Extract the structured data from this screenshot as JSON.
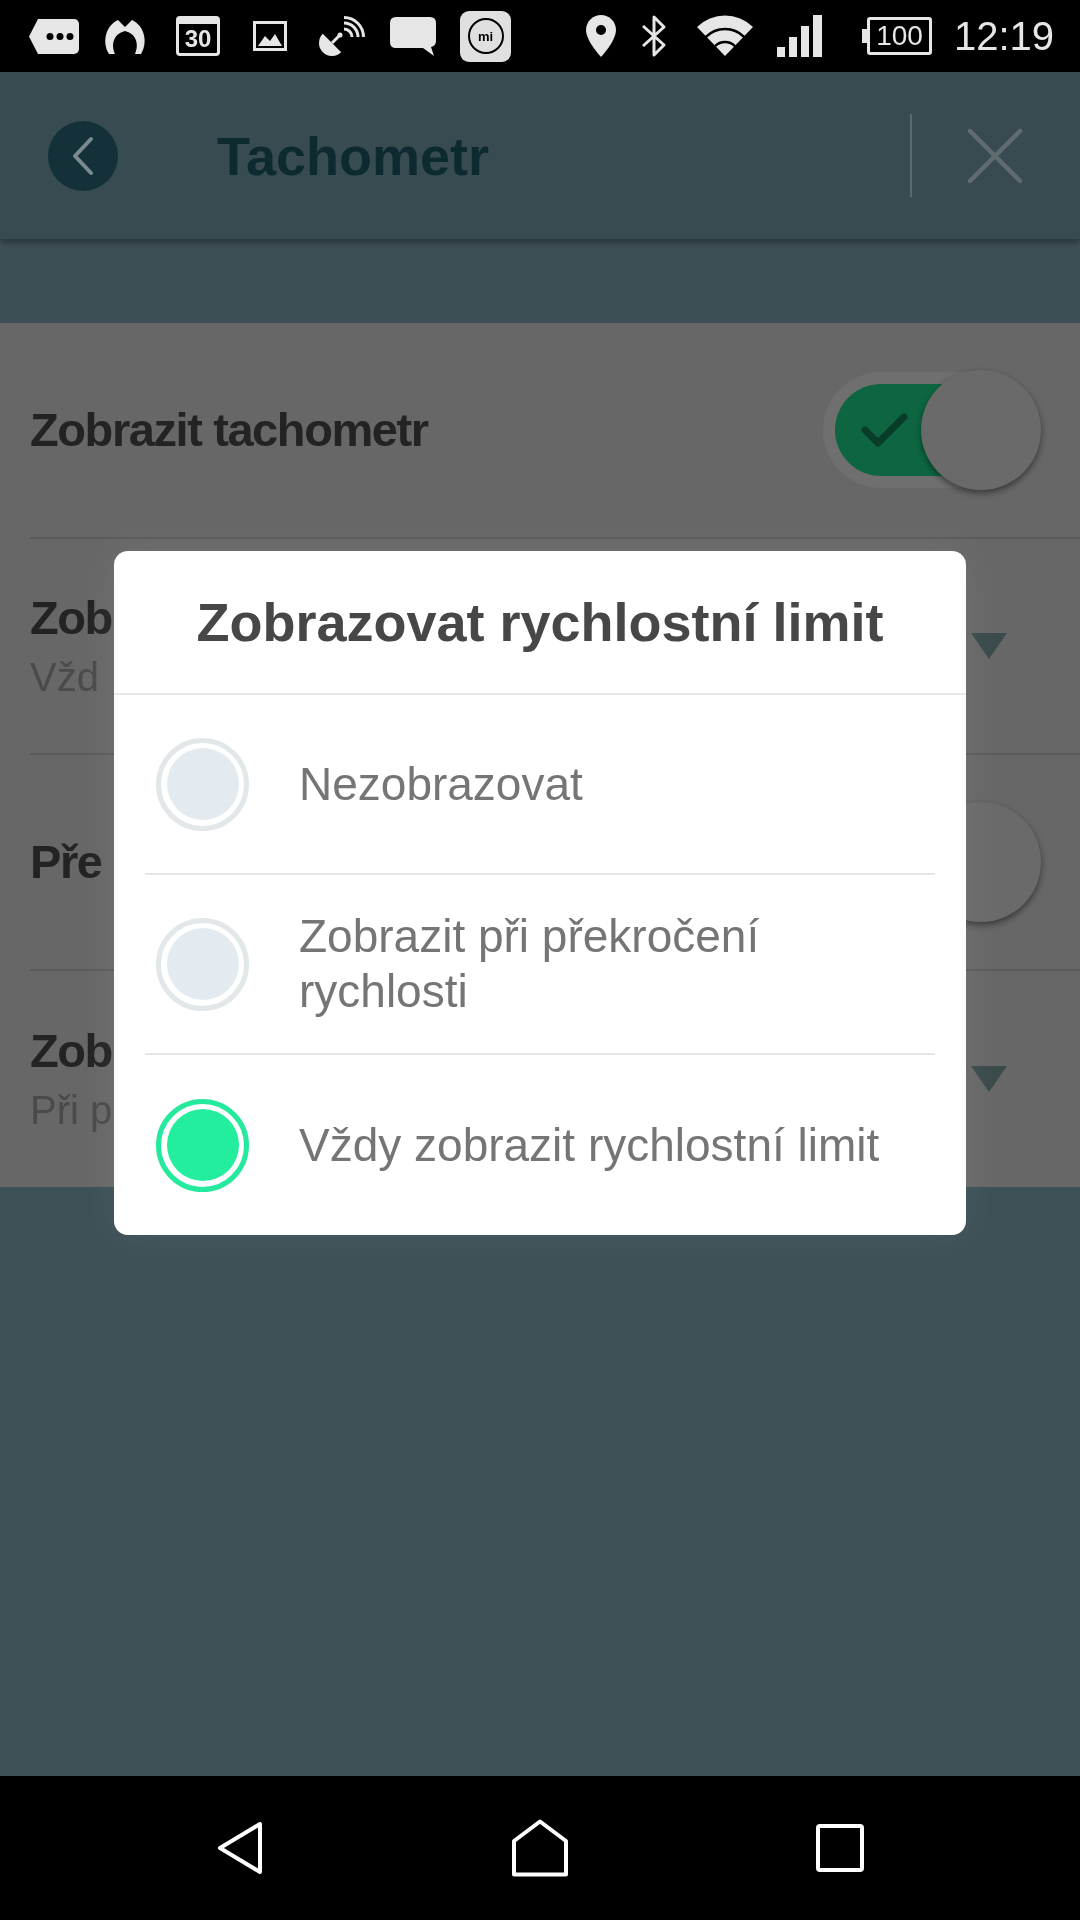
{
  "status_bar": {
    "calendar_day": "30",
    "app_logo_text": "mi",
    "battery": "100",
    "time": "12:19"
  },
  "header": {
    "title": "Tachometr"
  },
  "settings": [
    {
      "kind": "switch",
      "title": "Zobrazit tachometr",
      "on": true
    },
    {
      "kind": "dropdown",
      "title": "Zob",
      "value": "Vžd"
    },
    {
      "kind": "switch",
      "title": "Pře",
      "on": true
    },
    {
      "kind": "dropdown",
      "title": "Zob",
      "value": "Při p"
    }
  ],
  "dialog": {
    "title": "Zobrazovat rychlostní limit",
    "options": [
      {
        "label": "Nezobrazovat",
        "selected": false
      },
      {
        "label": "Zobrazit při překročení rychlosti",
        "selected": false
      },
      {
        "label": "Vždy zobrazit rychlostní limit",
        "selected": true
      }
    ]
  }
}
